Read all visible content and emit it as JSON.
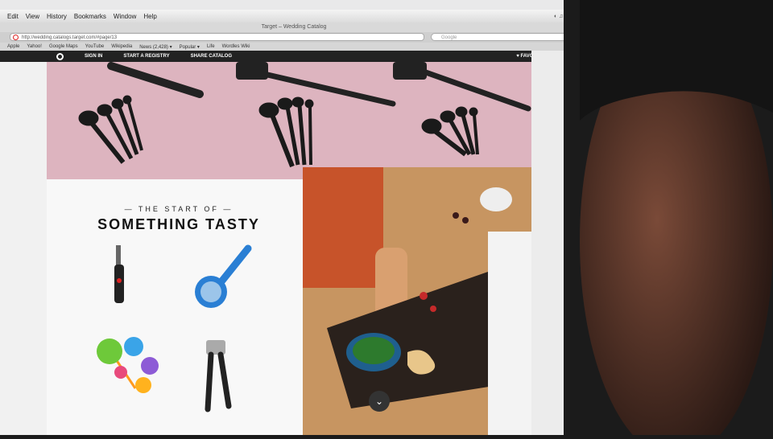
{
  "browser": {
    "menu": [
      "Edit",
      "View",
      "History",
      "Bookmarks",
      "Window",
      "Help"
    ],
    "window_title": "Target – Wedding Catalog",
    "url": "http://wedding.catalogs.target.com/#page/13",
    "search_placeholder": "Google",
    "bookmarks": [
      "Apple",
      "Yahoo!",
      "Google Maps",
      "YouTube",
      "Wikipedia",
      "News (2,428) ▾",
      "Popular ▾",
      "Life",
      "Wordles Wiki"
    ]
  },
  "site_nav": {
    "items": [
      "SIGN IN",
      "START A REGISTRY",
      "SHARE CATALOG"
    ],
    "favorites": "FAVORITES"
  },
  "catalog": {
    "kicker": "— THE START OF —",
    "headline": "SOMETHING TASTY"
  },
  "colors": {
    "accent": "#2a7fd4",
    "brand": "#cc0000",
    "hero_bg": "#ddb4bf"
  }
}
